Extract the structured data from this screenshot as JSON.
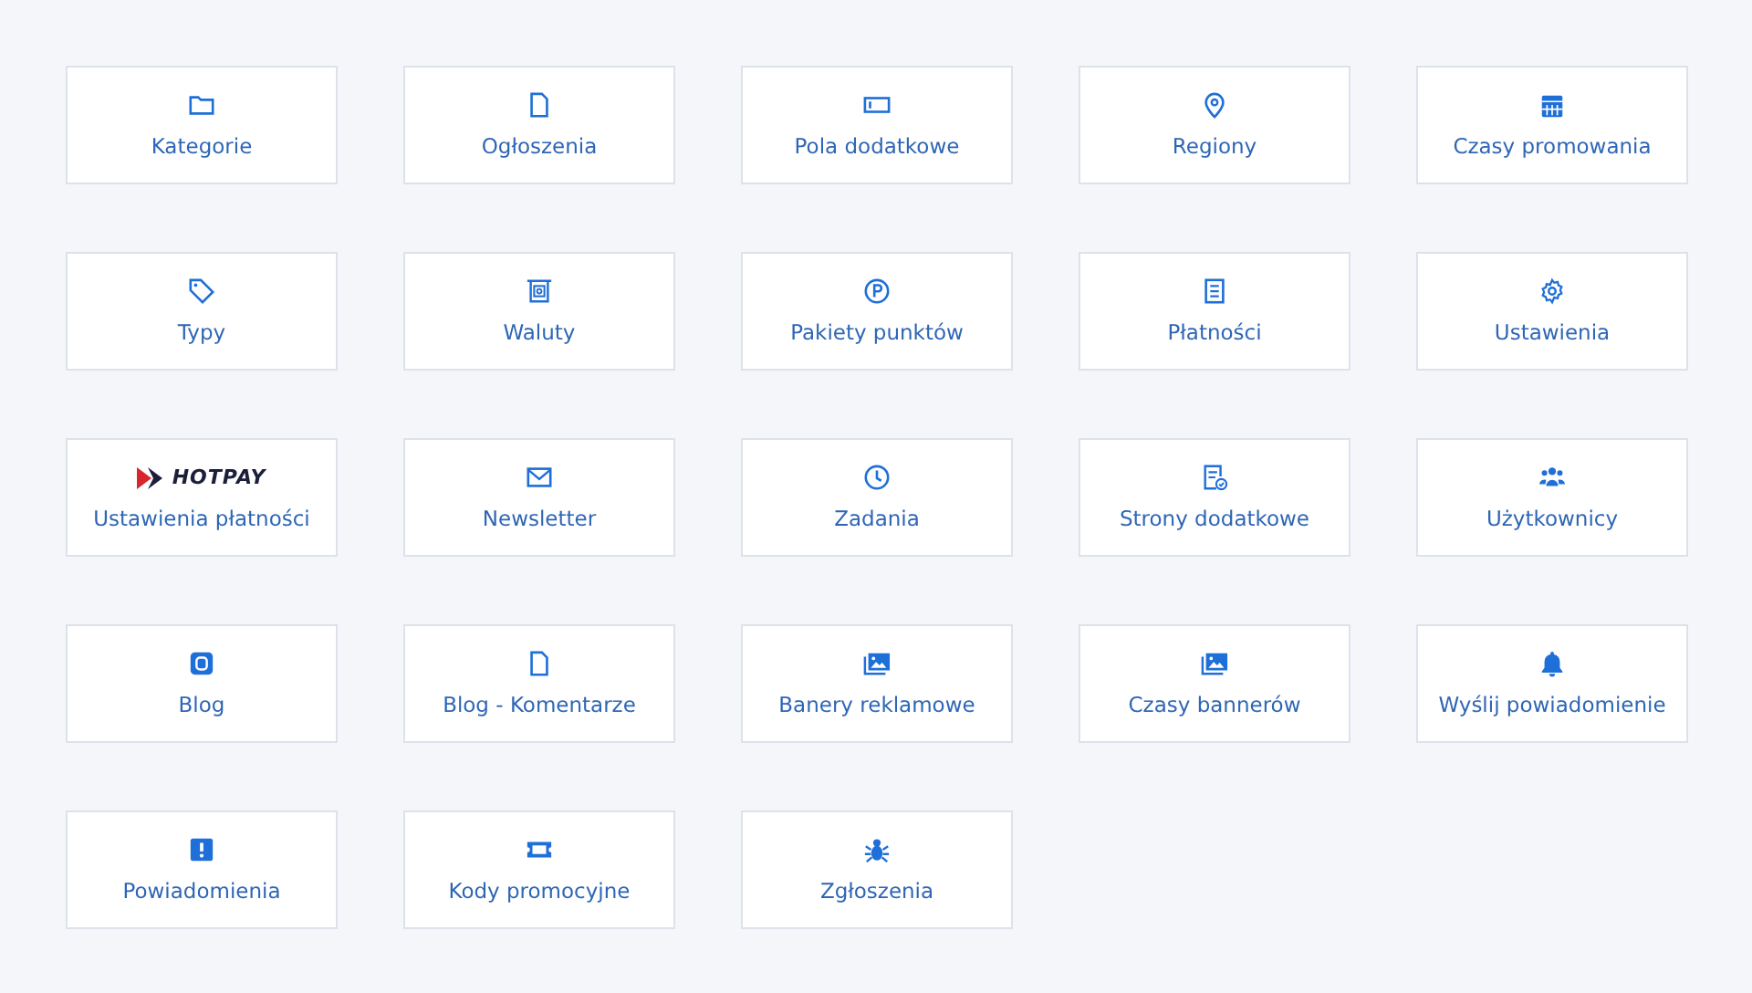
{
  "tiles": [
    {
      "label": "Kategorie"
    },
    {
      "label": "Ogłoszenia"
    },
    {
      "label": "Pola dodatkowe"
    },
    {
      "label": "Regiony"
    },
    {
      "label": "Czasy promowania"
    },
    {
      "label": "Typy"
    },
    {
      "label": "Waluty"
    },
    {
      "label": "Pakiety punktów"
    },
    {
      "label": "Płatności"
    },
    {
      "label": "Ustawienia"
    },
    {
      "label": "Ustawienia płatności",
      "logo": "HOTPAY"
    },
    {
      "label": "Newsletter"
    },
    {
      "label": "Zadania"
    },
    {
      "label": "Strony dodatkowe"
    },
    {
      "label": "Użytkownicy"
    },
    {
      "label": "Blog"
    },
    {
      "label": "Blog - Komentarze"
    },
    {
      "label": "Banery reklamowe"
    },
    {
      "label": "Czasy bannerów"
    },
    {
      "label": "Wyślij powiadomienie"
    },
    {
      "label": "Powiadomienia"
    },
    {
      "label": "Kody promocyjne"
    },
    {
      "label": "Zgłoszenia"
    }
  ]
}
